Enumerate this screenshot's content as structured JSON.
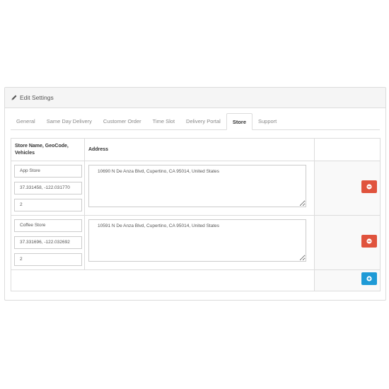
{
  "panel": {
    "title": "Edit Settings",
    "icon": "pencil-icon"
  },
  "tabs": [
    {
      "label": "General"
    },
    {
      "label": "Same Day Delivery"
    },
    {
      "label": "Customer Order"
    },
    {
      "label": "Time Slot"
    },
    {
      "label": "Delivery Portal"
    },
    {
      "label": "Store",
      "active": true
    },
    {
      "label": "Support"
    }
  ],
  "table": {
    "headers": {
      "store": "Store Name, GeoCode, Vehicles",
      "address": "Address",
      "action": ""
    },
    "rows": [
      {
        "name": "App Store",
        "geocode": "37.331458, -122.031770",
        "vehicles": "2",
        "address": "10690 N De Anza Blvd, Cupertino, CA 95014, United States"
      },
      {
        "name": "Coffee Store",
        "geocode": "37.331696, -122.032692",
        "vehicles": "2",
        "address": "10591 N De Anza Blvd, Cupertino, CA 95014, United States"
      }
    ]
  },
  "colors": {
    "remove_button": "#e0533d",
    "add_button": "#1e9ad6"
  }
}
